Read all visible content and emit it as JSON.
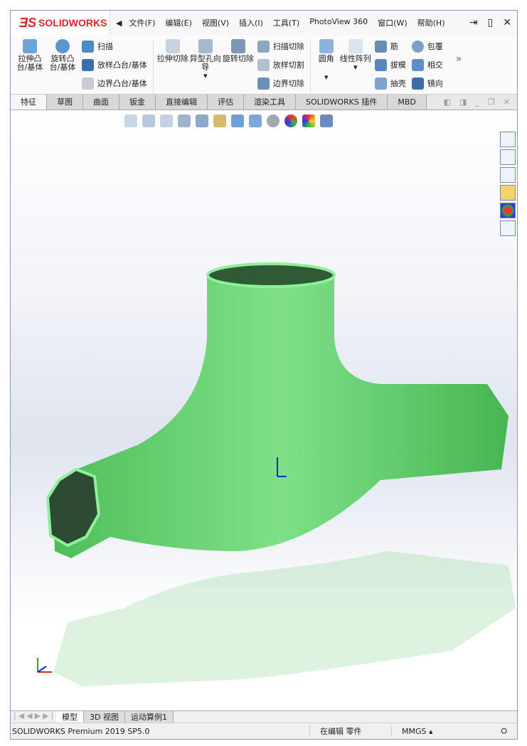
{
  "app": {
    "logo_text": "SOLIDWORKS"
  },
  "menu": [
    "文件(F)",
    "编辑(E)",
    "视图(V)",
    "插入(I)",
    "工具(T)",
    "PhotoView 360",
    "窗口(W)",
    "帮助(H)"
  ],
  "ribbon": {
    "g1_big": [
      "拉伸凸台/基体",
      "旋转凸台/基体"
    ],
    "g1_small": [
      "扫描",
      "放样凸台/基体",
      "边界凸台/基体"
    ],
    "g2_big": [
      "拉伸切除",
      "异型孔向导",
      "旋转切除"
    ],
    "g2_small": [
      "扫描切除",
      "放样切割",
      "边界切除"
    ],
    "g3_big": [
      "圆角",
      "线性阵列"
    ],
    "g3_small": [
      "筋",
      "拔模",
      "抽壳"
    ],
    "g4_small": [
      "包覆",
      "相交",
      "镜向"
    ],
    "more": "»"
  },
  "tabs": [
    "特征",
    "草图",
    "曲面",
    "钣金",
    "直接编辑",
    "评估",
    "渲染工具",
    "SOLIDWORKS 插件",
    "MBD"
  ],
  "bottom_tabs": [
    "模型",
    "3D 视图",
    "运动算例1"
  ],
  "status": {
    "product": "SOLIDWORKS Premium 2019 SP5.0",
    "mode": "在编辑 零件",
    "units": "MMGS",
    "units_arrow": "▴"
  },
  "colors": {
    "model": "#5fd66a",
    "accent": "#d8282e"
  }
}
